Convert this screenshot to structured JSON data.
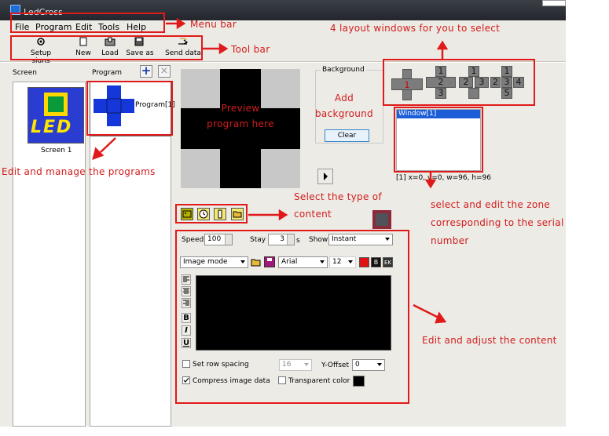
{
  "window": {
    "title": "LedCross"
  },
  "menu": [
    "File",
    "Program",
    "Edit",
    "Tools",
    "Help"
  ],
  "toolbar": {
    "setup": "Setup signs",
    "new": "New",
    "load": "Load",
    "save_as": "Save as",
    "send": "Send data"
  },
  "screen_panel": {
    "header": "Screen",
    "item_label": "Screen 1"
  },
  "program_panel": {
    "header": "Program",
    "item_label": "Program[1]"
  },
  "preview": {
    "text": "Preview\nprogram here"
  },
  "background": {
    "group_label": "Background",
    "add_text": "Add\nbackground",
    "clear_button": "Clear"
  },
  "windows_list": {
    "item": "Window[1]",
    "info": "[1] x=0, y=0, w=96, h=96"
  },
  "layouts": {
    "one": [
      "1"
    ],
    "three": [
      "1",
      "2",
      "3"
    ],
    "four": [
      "1",
      "2",
      "3"
    ],
    "five": [
      "1",
      "2",
      "3",
      "4",
      "5"
    ]
  },
  "settings": {
    "speed_label": "Speed",
    "speed_value": "100",
    "stay_label": "Stay",
    "stay_value": "3",
    "stay_unit": "s",
    "show_label": "Show",
    "show_value": "Instant",
    "mode_value": "Image mode",
    "font_value": "Arial",
    "size_value": "12",
    "color_btns": [
      "",
      "B",
      "EK"
    ],
    "format_btns": [
      "B",
      "I",
      "U"
    ],
    "row_spacing_label": "Set row spacing",
    "row_spacing_value": "16",
    "yoffset_label": "Y-Offset",
    "yoffset_value": "0",
    "compress_label": "Compress image data",
    "transparent_label": "Transparent color"
  },
  "annotations": {
    "menu_bar": "Menu bar",
    "tool_bar": "Tool bar",
    "layouts": "4   layout windows for you to select",
    "programs": "Edit and manage the programs",
    "content_type": "Select   the   type   of\ncontent",
    "zone": "select       and edit       the zone\ncorresponding     to     the     serial\nnumber",
    "adjust": "Edit and adjust the content"
  },
  "colors": {
    "annotation_red": "#e01a1a",
    "selection_blue": "#1c5ed8"
  }
}
